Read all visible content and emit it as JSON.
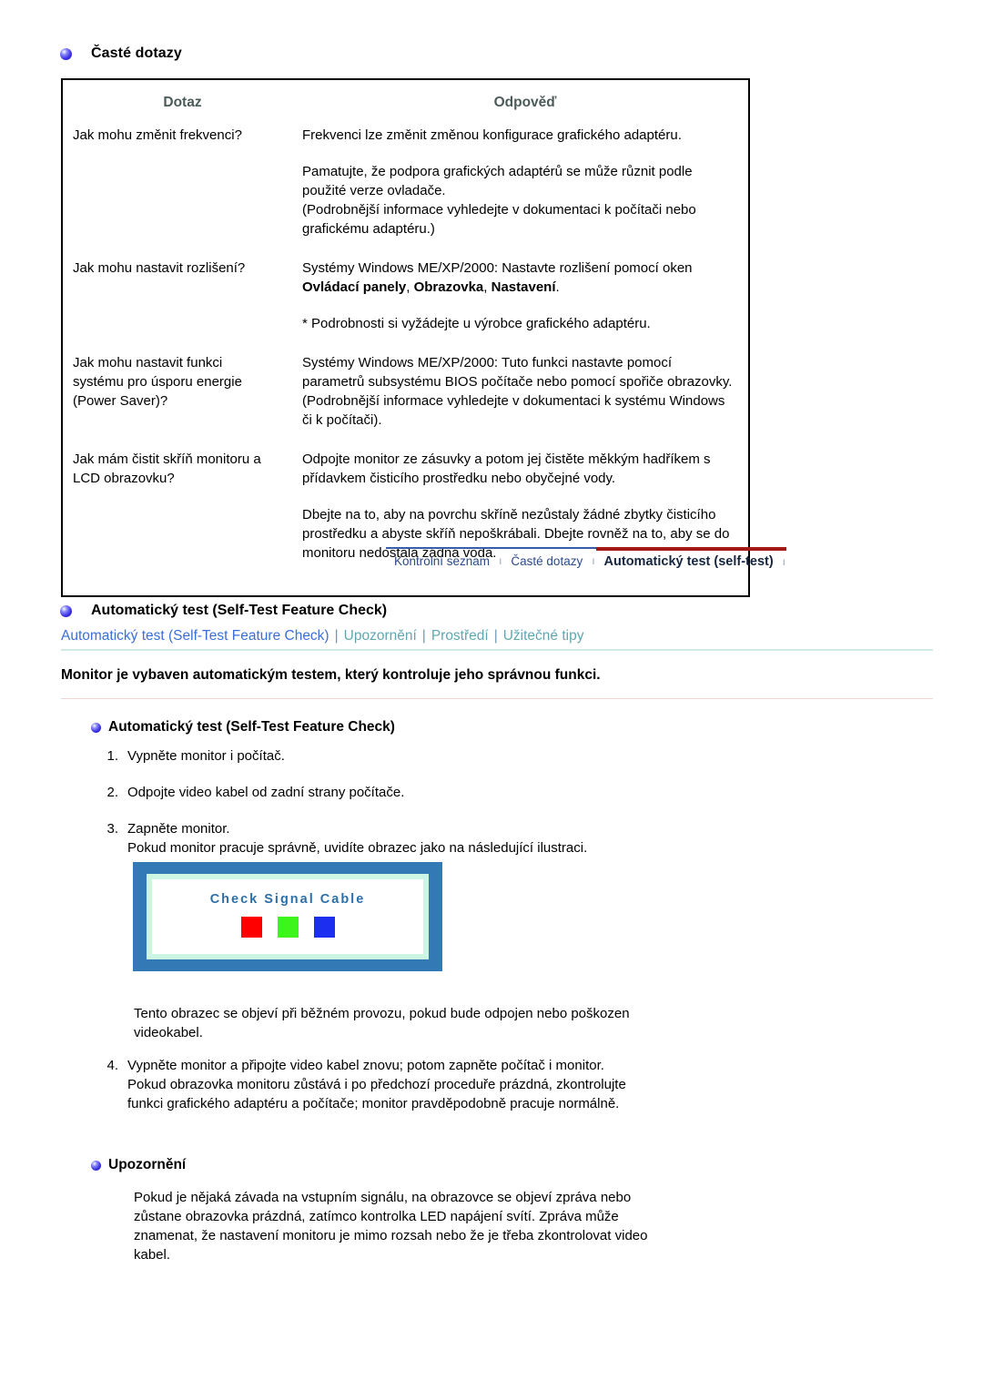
{
  "faq": {
    "section_title": "Časté dotazy",
    "columns": {
      "question": "Dotaz",
      "answer": "Odpověď"
    },
    "rows": [
      {
        "question": "Jak mohu změnit frekvenci?",
        "answer_p1": "Frekvenci lze změnit změnou konfigurace grafického adaptéru.",
        "answer_p2": "Pamatujte, že podpora grafických adaptérů se může různit podle použité verze ovladače.",
        "answer_p3": "(Podrobnější informace vyhledejte v dokumentaci k počítači nebo grafickému adaptéru.)"
      },
      {
        "question": "Jak mohu nastavit rozlišení?",
        "answer_p1_prefix": "Systémy Windows ME/XP/2000: Nastavte rozlišení pomocí oken ",
        "answer_p1_b1": "Ovládací panely",
        "answer_p1_mid1": ", ",
        "answer_p1_b2": "Obrazovka",
        "answer_p1_mid2": ", ",
        "answer_p1_b3": "Nastavení",
        "answer_p1_suffix": ".",
        "answer_p2": "* Podrobnosti si vyžádejte u výrobce grafického adaptéru."
      },
      {
        "question_l1": "Jak mohu nastavit funkci",
        "question_l2": "systému pro úsporu energie",
        "question_l3": "(Power Saver)?",
        "answer_p1": "Systémy Windows ME/XP/2000: Tuto funkci nastavte pomocí parametrů subsystému BIOS počítače nebo pomocí spořiče obrazovky. (Podrobnější informace vyhledejte v dokumentaci k systému Windows či k počítači)."
      },
      {
        "question_l1": "Jak mám čistit skříň monitoru a",
        "question_l2": "LCD obrazovku?",
        "answer_p1": "Odpojte monitor ze zásuvky a potom jej čistěte měkkým hadříkem s přídavkem čisticího prostředku nebo obyčejné vody.",
        "answer_p2": "Dbejte na to, aby na povrchu skříně nezůstaly žádné zbytky čisticího prostředku a abyste skříň nepoškrábali. Dbejte rovněž na to, aby se do monitoru nedostala žádná voda."
      }
    ]
  },
  "tabs": [
    {
      "label": "Kontrolní seznam",
      "active": false
    },
    {
      "label": "Časté dotazy",
      "active": false
    },
    {
      "label": "Automatický test (self-test)",
      "active": true
    }
  ],
  "tab_separator": "ı",
  "selftest": {
    "section_title": "Automatický test (Self-Test Feature Check)",
    "links": [
      {
        "label": "Automatický test (Self-Test Feature Check)",
        "color": "#3a6fd8"
      },
      {
        "label": "Upozornění",
        "color": "#5fa7b0"
      },
      {
        "label": "Prostředí",
        "color": "#5fa7b0"
      },
      {
        "label": "Užitečné tipy",
        "color": "#5fa7b0"
      }
    ],
    "link_separator": "|",
    "intro": "Monitor je vybaven automatickým testem, který kontroluje jeho správnou funkci.",
    "sub_heading": "Automatický test (Self-Test Feature Check)",
    "steps": [
      {
        "num": "1.",
        "line1": "Vypněte monitor i počítač."
      },
      {
        "num": "2.",
        "line1": "Odpojte video kabel od zadní strany počítače."
      },
      {
        "num": "3.",
        "line1": "Zapněte monitor.",
        "line2": "Pokud monitor pracuje správně, uvidíte obrazec jako na následující ilustraci."
      }
    ],
    "illustration": {
      "message": "Check Signal Cable",
      "bars": [
        {
          "name": "red-bar",
          "color": "#fe0000"
        },
        {
          "name": "green-bar",
          "color": "#3df51a"
        },
        {
          "name": "blue-bar",
          "color": "#1c2ef0"
        }
      ],
      "frame_color": "#3279b5",
      "bezel_color": "#cdf5e4",
      "screen_color": "#ffffff",
      "message_color": "#2f6fa8"
    },
    "after_illustration_l1": "Tento obrazec se objeví při běžném provozu, pokud bude odpojen nebo poškozen",
    "after_illustration_l2": "videokabel.",
    "step4": {
      "num": "4.",
      "line1": "Vypněte monitor a připojte video kabel znovu; potom zapněte počítač i monitor.",
      "line2": "Pokud obrazovka monitoru zůstává i po předchozí proceduře prázdná, zkontrolujte",
      "line3": "funkci grafického adaptéru a počítače; monitor pravděpodobně pracuje normálně."
    }
  },
  "warning": {
    "sub_heading": "Upozornění",
    "body_l1": "Pokud je nějaká závada na vstupním signálu, na obrazovce se objeví zpráva nebo",
    "body_l2": "zůstane obrazovka prázdná, zatímco kontrolka LED napájení svítí. Zpráva může",
    "body_l3": "znamenat, že nastavení monitoru je mimo rozsah nebo že je třeba zkontrolovat video",
    "body_l4": "kabel."
  },
  "colors": {
    "table_header_text": "#4b5b59",
    "tab_inactive_text": "#2b4a8b",
    "tab_active_text": "#16263f",
    "tab_active_border": "#a31916",
    "tab_border": "#345fa8",
    "link_blue": "#3a6fd8",
    "link_teal": "#5fa7b0"
  }
}
